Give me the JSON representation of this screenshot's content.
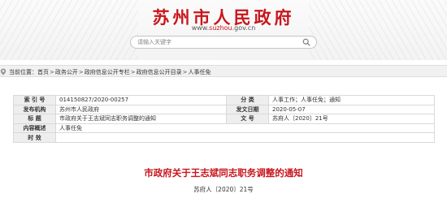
{
  "header": {
    "site_title": "苏州市人民政府",
    "url_prefix": "www.",
    "url_accent": "suzhou",
    "url_suffix": ".gov.cn",
    "search_placeholder": "请输入关键字"
  },
  "breadcrumb": {
    "prefix": "当前位置：",
    "items": [
      "首页",
      "政务公开",
      "政府信息公开专栏",
      "政府信息公开目录",
      "人事任免"
    ],
    "separator": ">"
  },
  "meta": {
    "rows": [
      {
        "l1": "索 引 号",
        "v1": "014150827/2020-00257",
        "l2": "分    类",
        "v2": "人事工作；人事任免；通知"
      },
      {
        "l1": "发布机构",
        "v1": "苏州市人民政府",
        "l2": "发文日期",
        "v2": "2020-05-07"
      },
      {
        "l1": "标    题",
        "v1": "市政府关于王志斌同志职务调整的通知",
        "l2": "文    号",
        "v2": "苏府人〔2020〕21号"
      },
      {
        "l1": "内容概述",
        "v1": "人事任免"
      },
      {
        "l1": "时    效",
        "v1": ""
      }
    ]
  },
  "document": {
    "title": "市政府关于王志斌同志职务调整的通知",
    "number": "苏府人〔2020〕21号"
  },
  "colors": {
    "brand_red": "#c8161d",
    "label_bg": "#eeeeee",
    "border": "#d9d9d9"
  }
}
